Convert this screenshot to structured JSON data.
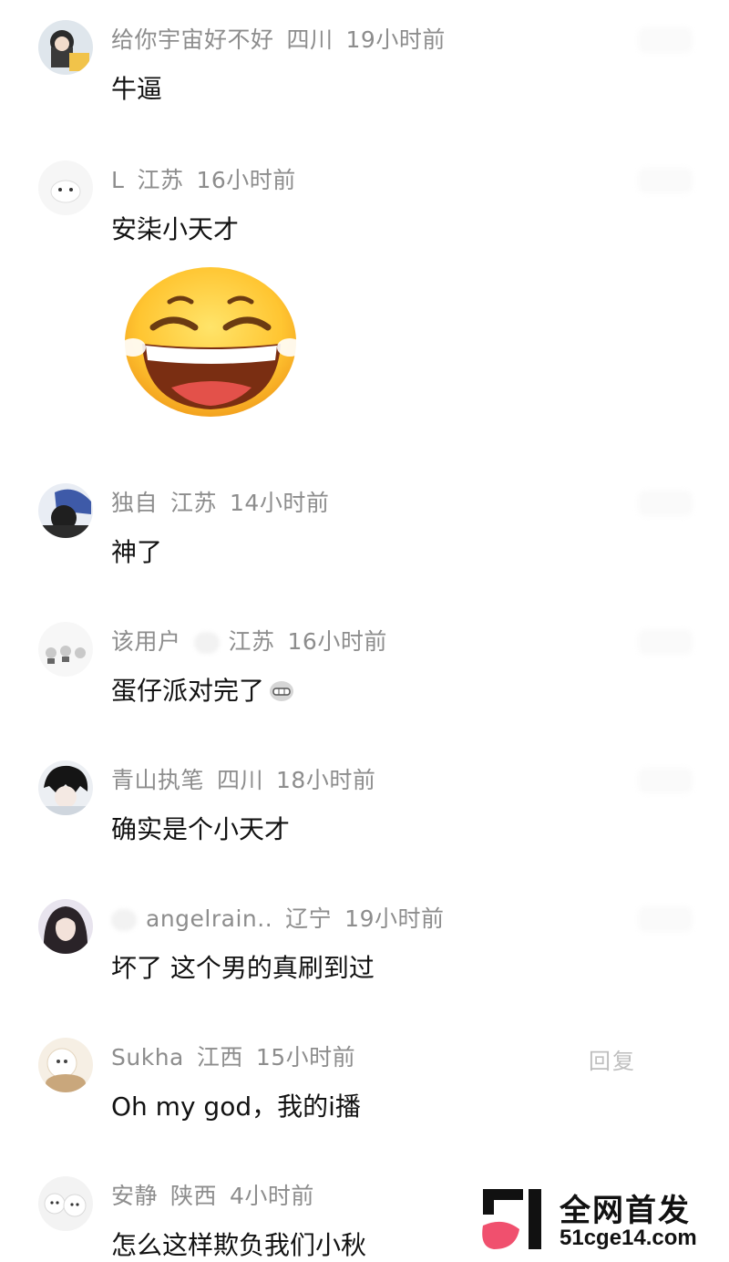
{
  "comments": [
    {
      "name": "给你宇宙好不好",
      "location": "四川",
      "time": "19小时前",
      "text": "牛逼"
    },
    {
      "name": "L",
      "location": "江苏",
      "time": "16小时前",
      "text": "安柒小天才",
      "sticker": "laughing-emoji"
    },
    {
      "name": "独自",
      "location": "江苏",
      "time": "14小时前",
      "text": "神了"
    },
    {
      "name": "该用户",
      "location": "江苏",
      "time": "16小时前",
      "text": "蛋仔派对完了",
      "inline_emoji": "grimace-emoji"
    },
    {
      "name": "青山执笔",
      "location": "四川",
      "time": "18小时前",
      "text": "确实是个小天才"
    },
    {
      "name": "angelrain..",
      "location": "辽宁",
      "time": "19小时前",
      "text": "坏了 这个男的真刷到过"
    },
    {
      "name": "Sukha",
      "location": "江西",
      "time": "15小时前",
      "text": "Oh my god，我的i播",
      "reply": "回复"
    },
    {
      "name": "安静",
      "location": "陕西",
      "time": "4小时前",
      "text": "怎么这样欺负我们小秋"
    }
  ],
  "watermark": {
    "title": "全网首发",
    "url": "51cge14.com"
  },
  "colors": {
    "meta": "#8d8d8d",
    "text": "#121212",
    "logo_pink": "#f0506e",
    "logo_black": "#111111"
  }
}
